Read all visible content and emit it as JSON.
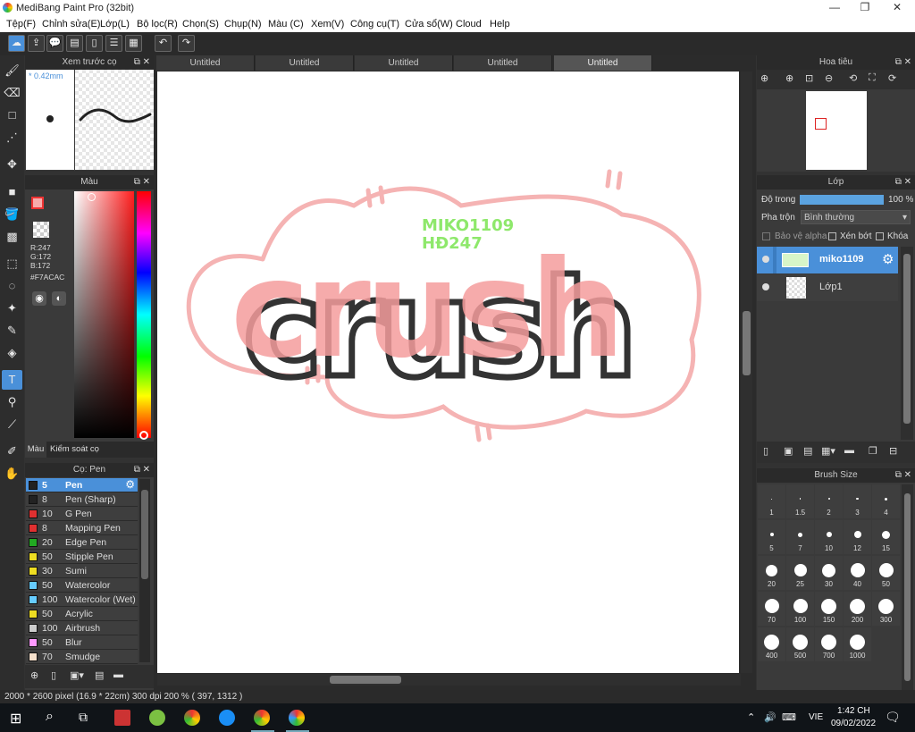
{
  "window": {
    "title": "MediBang Paint Pro (32bit)",
    "minimize": "—",
    "restore": "❐",
    "close": "✕"
  },
  "menu": [
    "Tệp(F)",
    "Chỉnh sửa(E)",
    "Lớp(L)",
    "Bộ lọc(R)",
    "Chọn(S)",
    "Chụp(N)",
    "Màu (C)",
    "Xem(V)",
    "Công cụ(T)",
    "Cửa sổ(W)",
    "Cloud",
    "Help"
  ],
  "tabs": [
    "Untitled",
    "Untitled",
    "Untitled",
    "Untitled",
    "Untitled"
  ],
  "preview": {
    "title": "Xem trước cọ",
    "size": "* 0.42mm"
  },
  "color": {
    "title": "Màu",
    "r": "R:247",
    "g": "G:172",
    "b": "B:172",
    "hex": "#F7ACAC",
    "tab1": "Màu",
    "tab2": "Kiểm soát cọ",
    "main": "#f7acac"
  },
  "brushes": {
    "title": "Cọ: Pen",
    "items": [
      {
        "size": "5",
        "name": "Pen",
        "color": "#222222"
      },
      {
        "size": "8",
        "name": "Pen (Sharp)",
        "color": "#222222"
      },
      {
        "size": "10",
        "name": "G Pen",
        "color": "#e03030"
      },
      {
        "size": "8",
        "name": "Mapping Pen",
        "color": "#e03030"
      },
      {
        "size": "20",
        "name": "Edge Pen",
        "color": "#22aa22"
      },
      {
        "size": "50",
        "name": "Stipple Pen",
        "color": "#eedd22"
      },
      {
        "size": "30",
        "name": "Sumi",
        "color": "#eedd22"
      },
      {
        "size": "50",
        "name": "Watercolor",
        "color": "#66ccff"
      },
      {
        "size": "100",
        "name": "Watercolor (Wet)",
        "color": "#66ccff"
      },
      {
        "size": "50",
        "name": "Acrylic",
        "color": "#eedd22"
      },
      {
        "size": "100",
        "name": "Airbrush",
        "color": "#cccccc"
      },
      {
        "size": "50",
        "name": "Blur",
        "color": "#ff99ff"
      },
      {
        "size": "70",
        "name": "Smudge",
        "color": "#f5e0cc"
      }
    ]
  },
  "navigator": {
    "title": "Hoa tiêu"
  },
  "layers": {
    "title": "Lớp",
    "opacity_label": "Độ trong",
    "opacity": "100 %",
    "opacity_pct": 100,
    "blend_label": "Pha trộn",
    "blend": "Bình thường",
    "protect_alpha": "Bảo vệ alpha",
    "clip": "Xén bớt",
    "lock": "Khóa",
    "items": [
      {
        "name": "miko1109"
      },
      {
        "name": "Lớp1"
      }
    ]
  },
  "brush_size": {
    "title": "Brush Size",
    "sizes": [
      "1",
      "1.5",
      "2",
      "3",
      "4",
      "5",
      "7",
      "10",
      "12",
      "15",
      "20",
      "25",
      "30",
      "40",
      "50",
      "70",
      "100",
      "150",
      "200",
      "300",
      "400",
      "500",
      "700",
      "1000"
    ]
  },
  "canvas": {
    "word": "crush",
    "sig1": "MIKO1109",
    "sig2": "HĐ247"
  },
  "status": {
    "text": "2000 * 2600 pixel  (16.9 * 22cm)  300 dpi  200 %  ( 397, 1312 )"
  },
  "taskbar": {
    "lang": "VIE",
    "time": "1:42 CH",
    "date": "09/02/2022"
  }
}
